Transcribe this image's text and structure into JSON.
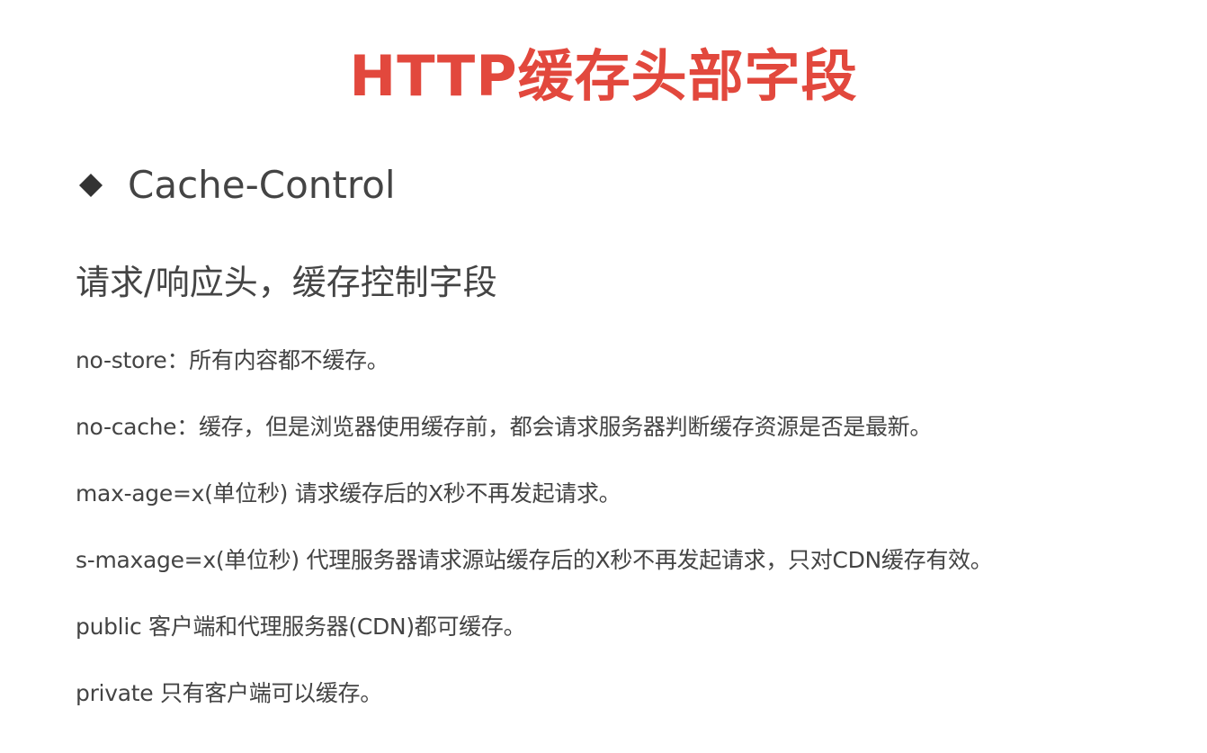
{
  "title": "HTTP缓存头部字段",
  "section": {
    "icon": "diamond-bullet-icon",
    "label": "Cache-Control"
  },
  "subtitle": "请求/响应头，缓存控制字段",
  "lines": [
    {
      "key": "no-store",
      "text": "：所有内容都不缓存。"
    },
    {
      "key": "no-cache",
      "text": "：缓存，但是浏览器使用缓存前，都会请求服务器判断缓存资源是否是最新。"
    },
    {
      "key": "max-age=x(单位秒)",
      "text": " 请求缓存后的X秒不再发起请求。"
    },
    {
      "key": "s-maxage=x(单位秒)",
      "text": " 代理服务器请求源站缓存后的X秒不再发起请求，只对CDN缓存有效。"
    },
    {
      "key": "public",
      "text": " 客户端和代理服务器(CDN)都可缓存。"
    },
    {
      "key": "private",
      "text": " 只有客户端可以缓存。"
    }
  ],
  "colors": {
    "title": "#e2483d",
    "text": "#444444",
    "bullet": "#333333",
    "background": "#ffffff"
  }
}
